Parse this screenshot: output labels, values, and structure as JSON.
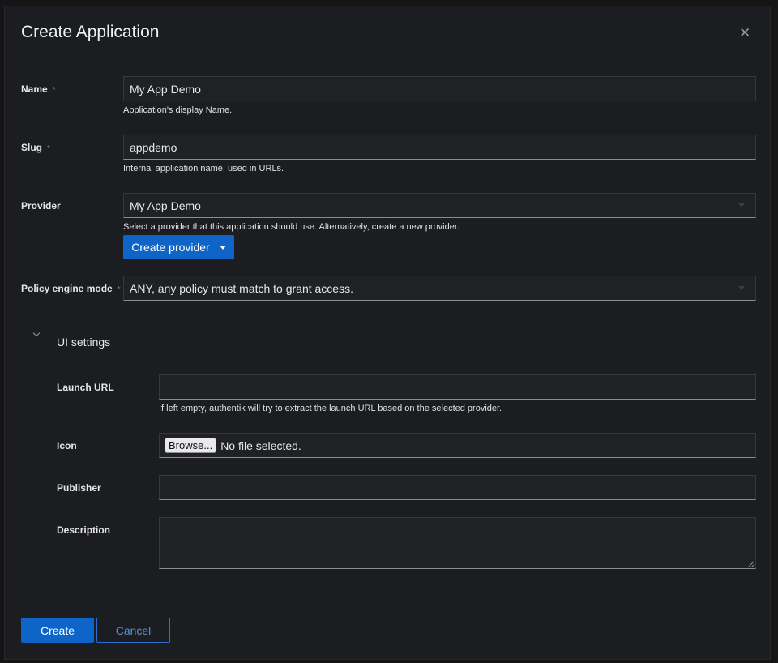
{
  "modal": {
    "title": "Create Application",
    "close_glyph": "✕"
  },
  "form": {
    "name": {
      "label": "Name",
      "required_mark": "*",
      "value": "My App Demo",
      "help": "Application's display Name."
    },
    "slug": {
      "label": "Slug",
      "required_mark": "*",
      "value": "appdemo",
      "help": "Internal application name, used in URLs."
    },
    "provider": {
      "label": "Provider",
      "value": "My App Demo",
      "help": "Select a provider that this application should use. Alternatively, create a new provider.",
      "create_button": "Create provider"
    },
    "policy_engine_mode": {
      "label": "Policy engine mode",
      "required_mark": "*",
      "value": "ANY, any policy must match to grant access."
    }
  },
  "ui_settings": {
    "label": "UI settings",
    "launch_url": {
      "label": "Launch URL",
      "value": "",
      "help": "If left empty, authentik will try to extract the launch URL based on the selected provider."
    },
    "icon": {
      "label": "Icon",
      "browse_button": "Browse...",
      "status": "No file selected."
    },
    "publisher": {
      "label": "Publisher",
      "value": ""
    },
    "description": {
      "label": "Description",
      "value": ""
    }
  },
  "footer": {
    "create_label": "Create",
    "cancel_label": "Cancel"
  },
  "colors": {
    "background": "#1b1d21",
    "primary": "#0f64c8",
    "secondary_border": "#2c6fd0"
  }
}
